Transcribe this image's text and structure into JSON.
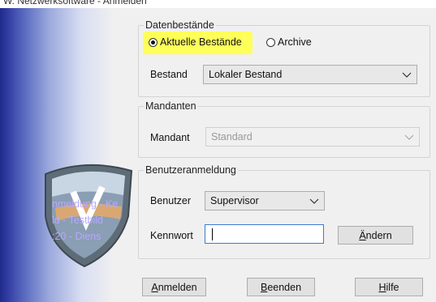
{
  "window": {
    "title": "W. Netzwerksoftware - Anmelden"
  },
  "shield_text": [
    "nmeldung - Ke",
    "ld - Testbild",
    ":20 - Diens"
  ],
  "data_section": {
    "title": "Datenbestände",
    "radio_current": "Aktuelle Bestände",
    "radio_archive": "Archive",
    "selected": "Aktuelle Bestände",
    "bestand_label": "Bestand",
    "bestand_value": "Lokaler Bestand"
  },
  "mandanten_section": {
    "title": "Mandanten",
    "mandant_label": "Mandant",
    "mandant_value": "Standard"
  },
  "login_section": {
    "title": "Benutzeranmeldung",
    "user_label": "Benutzer",
    "user_value": "Supervisor",
    "password_label": "Kennwort",
    "password_value": "",
    "change_button": {
      "u": "Ä",
      "rest": "ndern"
    }
  },
  "buttons": {
    "login": {
      "u": "A",
      "rest": "nmelden"
    },
    "quit": {
      "u": "B",
      "rest": "eenden"
    },
    "help": {
      "u": "H",
      "rest": "ilfe"
    }
  },
  "colors": {
    "highlight": "#ffff5a",
    "left_panel": "#2e3aa0",
    "focus_border": "#3a7bd5"
  }
}
